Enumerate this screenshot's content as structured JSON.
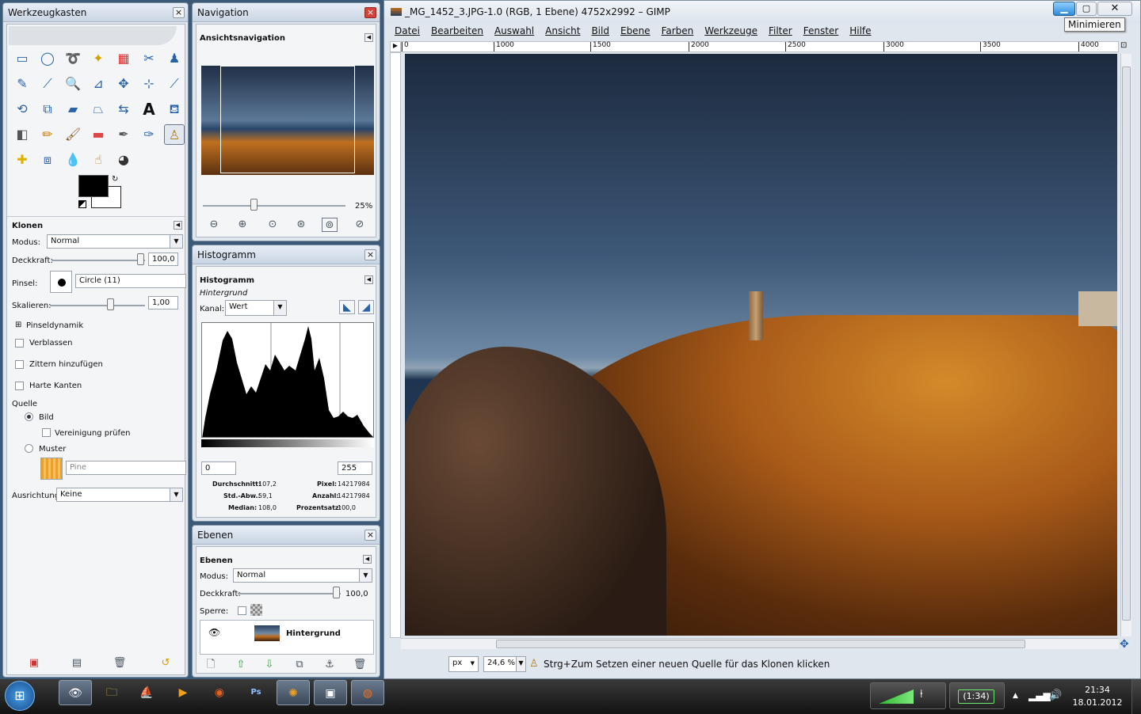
{
  "toolbox": {
    "title": "Werkzeugkasten",
    "tool_name": "Klonen",
    "modus_label": "Modus:",
    "modus_value": "Normal",
    "deckkraft_label": "Deckkraft:",
    "deckkraft_value": "100,0",
    "pinsel_label": "Pinsel:",
    "pinsel_value": "Circle (11)",
    "skalieren_label": "Skalieren:",
    "skalieren_value": "1,00",
    "pinseldynamik": "Pinseldynamik",
    "verblassen": "Verblassen",
    "zittern": "Zittern hinzufügen",
    "harte_kanten": "Harte Kanten",
    "quelle_label": "Quelle",
    "bild": "Bild",
    "vereinigung": "Vereinigung prüfen",
    "muster": "Muster",
    "muster_value": "Pine",
    "ausrichtung_label": "Ausrichtung:",
    "ausrichtung_value": "Keine"
  },
  "navigation": {
    "title": "Navigation",
    "subtitle": "Ansichtsnavigation",
    "zoom": "25%"
  },
  "histogram": {
    "title": "Histogramm",
    "subtitle": "Histogramm",
    "layer": "Hintergrund",
    "kanal_label": "Kanal:",
    "kanal_value": "Wert",
    "range_min": "0",
    "range_max": "255",
    "stats": {
      "durchschnitt_label": "Durchschnitt:",
      "durchschnitt": "107,2",
      "std_label": "Std.-Abw.:",
      "std": "59,1",
      "median_label": "Median:",
      "median": "108,0",
      "pixel_label": "Pixel:",
      "pixel": "14217984",
      "anzahl_label": "Anzahl:",
      "anzahl": "14217984",
      "prozent_label": "Prozentsatz:",
      "prozent": "100,0"
    }
  },
  "layers": {
    "title": "Ebenen",
    "subtitle": "Ebenen",
    "modus_label": "Modus:",
    "modus_value": "Normal",
    "deckkraft_label": "Deckkraft:",
    "deckkraft_value": "100,0",
    "sperre_label": "Sperre:",
    "layer_name": "Hintergrund"
  },
  "image_window": {
    "title": "_MG_1452_3.JPG-1.0 (RGB, 1 Ebene) 4752x2992 – GIMP",
    "tooltip": "Minimieren",
    "menu": [
      "Datei",
      "Bearbeiten",
      "Auswahl",
      "Ansicht",
      "Bild",
      "Ebene",
      "Farben",
      "Werkzeuge",
      "Filter",
      "Fenster",
      "Hilfe"
    ],
    "ruler_ticks": [
      "0",
      "1000",
      "1500",
      "2000",
      "2500",
      "3000",
      "3500",
      "4000"
    ],
    "unit": "px",
    "zoom": "24,6 %",
    "status": "Strg+Zum Setzen einer neuen Quelle für das Klonen klicken"
  },
  "taskbar": {
    "time": "21:34",
    "date": "18.01.2012",
    "battery": "(1:34)"
  }
}
